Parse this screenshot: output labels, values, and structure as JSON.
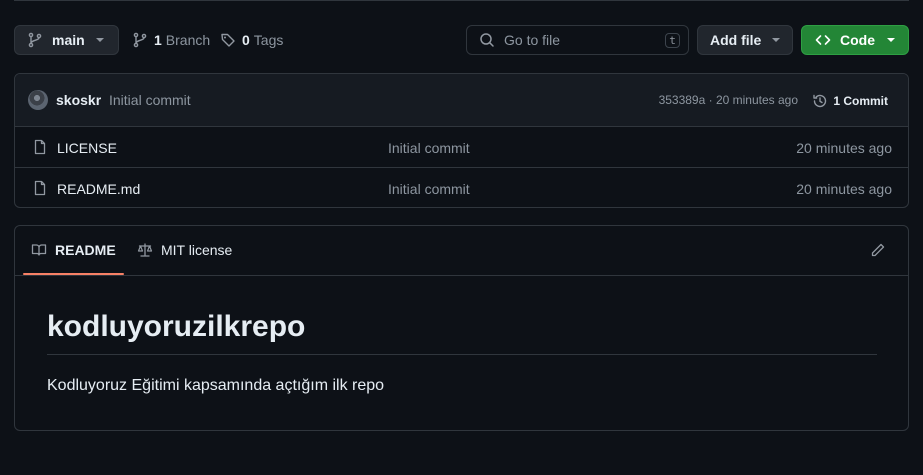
{
  "toolbar": {
    "branch_name": "main",
    "branch_count": "1",
    "branch_label": "Branch",
    "tag_count": "0",
    "tag_label": "Tags",
    "search_placeholder": "Go to file",
    "search_shortcut": "t",
    "add_file_label": "Add file",
    "code_label": "Code"
  },
  "last_commit": {
    "author": "skoskr",
    "message": "Initial commit",
    "sha_time": "353389a · 20 minutes ago",
    "commits_label": "1 Commit"
  },
  "files": [
    {
      "name": "LICENSE",
      "message": "Initial commit",
      "age": "20 minutes ago",
      "icon": "file-icon"
    },
    {
      "name": "README.md",
      "message": "Initial commit",
      "age": "20 minutes ago",
      "icon": "file-icon"
    }
  ],
  "readme": {
    "tabs": [
      {
        "label": "README",
        "icon": "book-icon",
        "active": true
      },
      {
        "label": "MIT license",
        "icon": "scale-icon",
        "active": false
      }
    ],
    "heading": "kodluyoruzilkrepo",
    "body": "Kodluyoruz Eğitimi kapsamında açtığım ilk repo"
  },
  "colors": {
    "background": "#0d1117",
    "border": "#30363d",
    "code_button": "#238636",
    "active_tab_underline": "#f78166",
    "muted_text": "#8d96a0"
  }
}
